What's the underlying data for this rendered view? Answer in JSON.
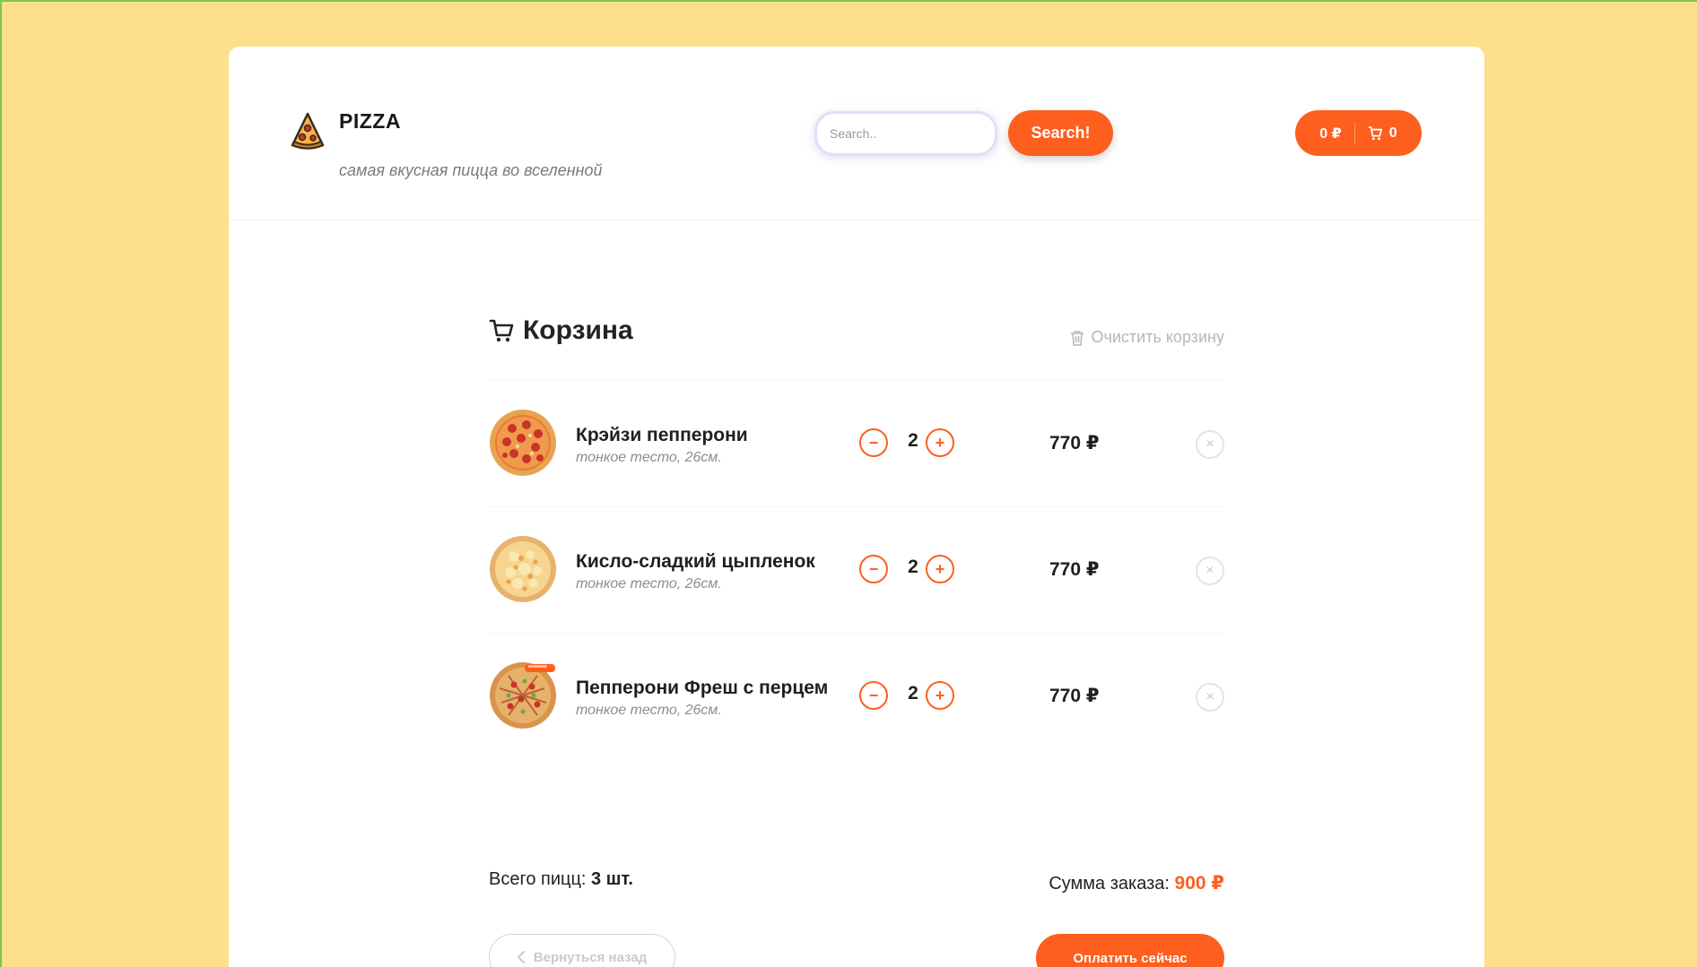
{
  "header": {
    "logo_title": "PIZZA",
    "logo_subtitle": "самая вкусная пицца во вселенной",
    "search_placeholder": "Search..",
    "search_button": "Search!",
    "cart_total": "0 ₽",
    "cart_count": "0"
  },
  "cart": {
    "title": "Корзина",
    "clear_label": "Очистить корзину",
    "items": [
      {
        "name": "Крэйзи пепперони",
        "desc": "тонкое тесто, 26см.",
        "qty": "2",
        "price": "770 ₽",
        "minus": "−",
        "plus": "+",
        "remove": "×"
      },
      {
        "name": "Кисло-сладкий цыпленок",
        "desc": "тонкое тесто, 26см.",
        "qty": "2",
        "price": "770 ₽",
        "minus": "−",
        "plus": "+",
        "remove": "×"
      },
      {
        "name": "Пепперони Фреш с перцем",
        "desc": "тонкое тесто, 26см.",
        "qty": "2",
        "price": "770 ₽",
        "minus": "−",
        "plus": "+",
        "remove": "×",
        "badge": "новинка"
      }
    ],
    "total_count_label": "Всего пицц:",
    "total_count_value": "3 шт.",
    "total_sum_label": "Сумма заказа:",
    "total_sum_value": "900 ₽",
    "back_label": "Вернуться назад",
    "pay_label": "Оплатить сейчас"
  },
  "colors": {
    "accent": "#fe5f1e",
    "background": "#fedf8c"
  }
}
